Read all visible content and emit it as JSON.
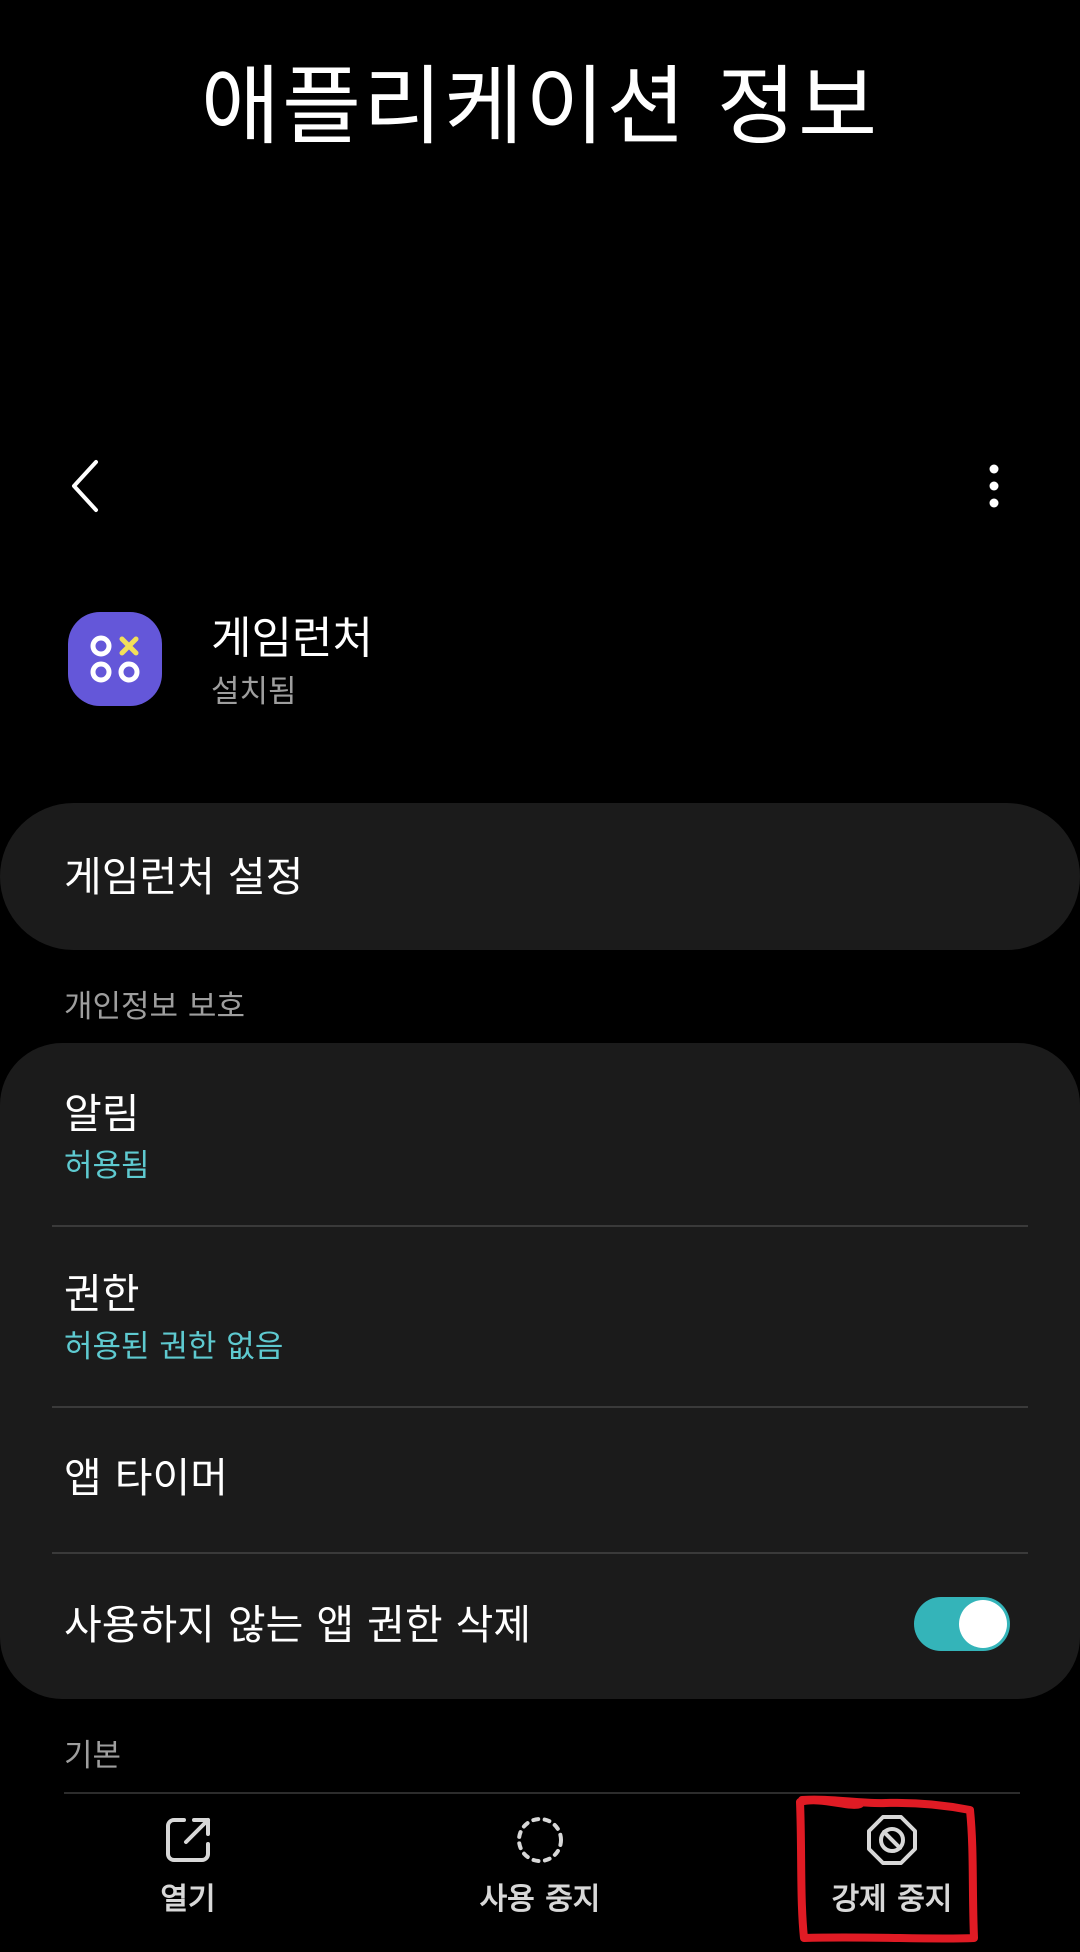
{
  "page": {
    "title": "애플리케이션 정보"
  },
  "app": {
    "name": "게임런처",
    "status": "설치됨",
    "icon": "game-launcher-icon",
    "icon_color": "#6457d9",
    "icon_accent": "#f2df59"
  },
  "settings_card": {
    "label": "게임런처 설정"
  },
  "privacy_section": {
    "header": "개인정보 보호",
    "items": [
      {
        "title": "알림",
        "subtitle": "허용됨"
      },
      {
        "title": "권한",
        "subtitle": "허용된 권한 없음"
      },
      {
        "title": "앱 타이머"
      },
      {
        "title": "사용하지 않는 앱 권한 삭제",
        "toggle_on": true
      }
    ]
  },
  "basic_section": {
    "header": "기본"
  },
  "bottom_actions": [
    {
      "label": "열기",
      "icon": "open-external-icon"
    },
    {
      "label": "사용 중지",
      "icon": "disable-icon"
    },
    {
      "label": "강제 중지",
      "icon": "force-stop-icon"
    }
  ],
  "colors": {
    "background": "#000000",
    "card": "#1b1b1b",
    "accent_text": "#5ecad0",
    "toggle_on": "#34b4b9",
    "annotation": "#e01b24"
  }
}
